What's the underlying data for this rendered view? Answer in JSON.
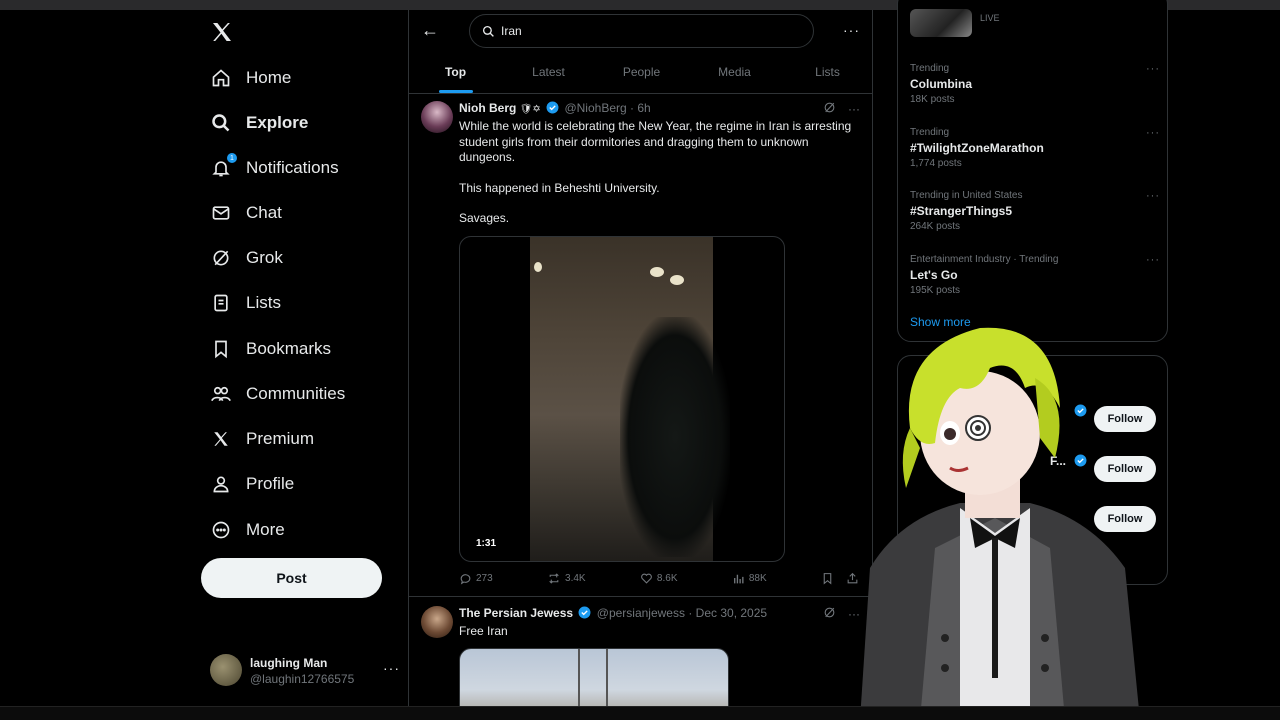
{
  "nav": {
    "logo": "X",
    "items": [
      {
        "label": "Home",
        "icon": "home-icon"
      },
      {
        "label": "Explore",
        "icon": "search-icon",
        "active": true
      },
      {
        "label": "Notifications",
        "icon": "bell-icon",
        "badge": "1"
      },
      {
        "label": "Chat",
        "icon": "mail-icon"
      },
      {
        "label": "Grok",
        "icon": "grok-icon"
      },
      {
        "label": "Lists",
        "icon": "list-icon"
      },
      {
        "label": "Bookmarks",
        "icon": "bookmark-icon"
      },
      {
        "label": "Communities",
        "icon": "communities-icon"
      },
      {
        "label": "Premium",
        "icon": "x-logo-icon"
      },
      {
        "label": "Profile",
        "icon": "person-icon"
      },
      {
        "label": "More",
        "icon": "more-circle-icon"
      }
    ],
    "post_label": "Post"
  },
  "account": {
    "name": "laughing Man",
    "handle": "@laughin12766575",
    "more": "···"
  },
  "search": {
    "query": "Iran",
    "back": "←",
    "more": "···"
  },
  "tabs": [
    "Top",
    "Latest",
    "People",
    "Media",
    "Lists"
  ],
  "tweets": [
    {
      "name": "Nioh Berg",
      "badges": "🛡✡",
      "handle": "@NiohBerg",
      "sep": "·",
      "time": "6h",
      "text_lines": [
        "While the world is celebrating the New Year, the regime in Iran is arresting student girls from their dormitories and dragging them to unknown dungeons.",
        "This happened in Beheshti University.",
        "Savages."
      ],
      "duration": "1:31",
      "replies": "273",
      "reposts": "3.4K",
      "likes": "8.6K",
      "views": "88K"
    },
    {
      "name": "The Persian Jewess",
      "handle": "@persianjewess",
      "sep": "·",
      "time": "Dec 30, 2025",
      "text": "Free Iran"
    }
  ],
  "sidebar": {
    "live_label": "LIVE",
    "trends": [
      {
        "context": "Trending",
        "name": "Columbina",
        "count": "18K posts"
      },
      {
        "context": "Trending",
        "name": "#TwilightZoneMarathon",
        "count": "1,774 posts"
      },
      {
        "context": "Trending in United States",
        "name": "#StrangerThings5",
        "count": "264K posts"
      },
      {
        "context": "Entertainment Industry · Trending",
        "name": "Let's Go",
        "count": "195K posts"
      }
    ],
    "show_more": "Show more",
    "follow_label": "Follow",
    "who_to_follow_partial": "F..."
  },
  "colors": {
    "accent": "#1d9bf0",
    "background": "#000000",
    "text": "#e7e9ea",
    "muted": "#71767b",
    "border": "#2f3336"
  }
}
